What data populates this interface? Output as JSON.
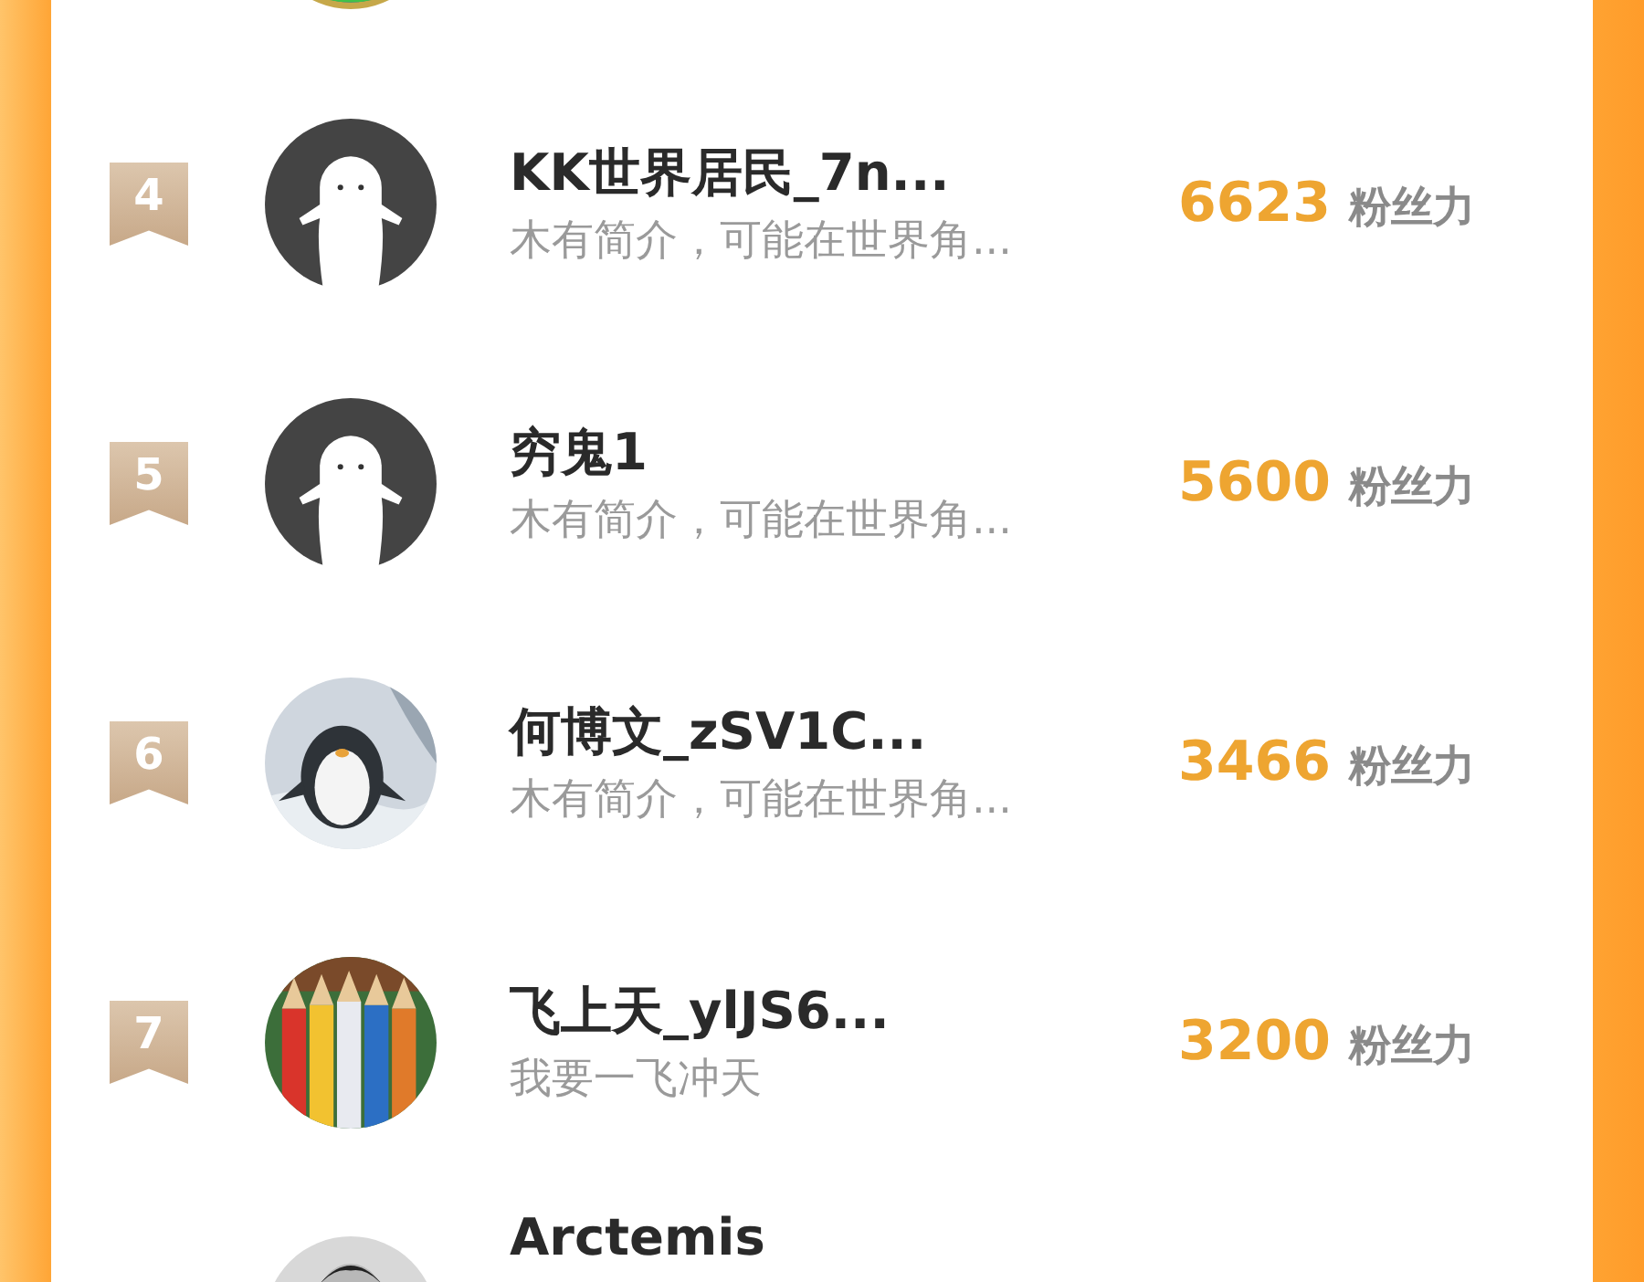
{
  "ranking": [
    {
      "avatar": {
        "kind": "partial-top"
      }
    },
    {
      "rank": "4",
      "avatar": {
        "kind": "default"
      },
      "name": "KK世界居民_7n...",
      "bio": "木有简介，可能在世界角...",
      "score": "6623",
      "score_unit": "粉丝力"
    },
    {
      "rank": "5",
      "avatar": {
        "kind": "default"
      },
      "name": "穷鬼1",
      "bio": "木有简介，可能在世界角...",
      "score": "5600",
      "score_unit": "粉丝力"
    },
    {
      "rank": "6",
      "avatar": {
        "kind": "penguin"
      },
      "name": "何博文_zSV1C...",
      "bio": "木有简介，可能在世界角...",
      "score": "3466",
      "score_unit": "粉丝力"
    },
    {
      "rank": "7",
      "avatar": {
        "kind": "pencils"
      },
      "name": "飞上天_ylJS6...",
      "bio": "我要一飞冲天",
      "score": "3200",
      "score_unit": "粉丝力"
    },
    {
      "avatar": {
        "kind": "portrait"
      },
      "name": "Arctemis"
    }
  ]
}
